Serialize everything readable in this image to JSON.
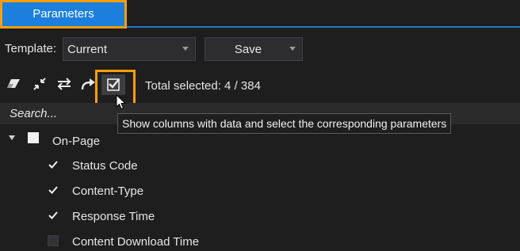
{
  "tabs": [
    {
      "label": "Parameters",
      "active": true
    }
  ],
  "template_row": {
    "label": "Template:",
    "selected_template": "Current",
    "save_label": "Save"
  },
  "toolbar": {
    "icons": [
      "eraser-icon",
      "collapse-icon",
      "swap-icon",
      "redo-icon",
      "checkbox-select-icon"
    ],
    "total_selected": "Total selected: 4 / 384"
  },
  "search": {
    "placeholder": "Search..."
  },
  "tooltip": {
    "text": "Show columns with data and select the corresponding parameters"
  },
  "tree": {
    "group": {
      "label": "On-Page",
      "state": "partial",
      "expanded": true
    },
    "items": [
      {
        "label": "Status Code",
        "checked": true
      },
      {
        "label": "Content-Type",
        "checked": true
      },
      {
        "label": "Response Time",
        "checked": true
      },
      {
        "label": "Content Download Time",
        "checked": false
      }
    ]
  },
  "colors": {
    "accent": "#1c7fdd",
    "highlight": "#ff9d0a",
    "background": "#1e1e1e"
  }
}
